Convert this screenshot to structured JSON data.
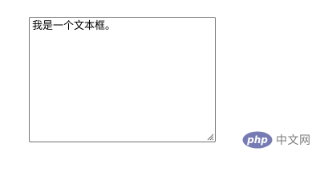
{
  "textarea": {
    "value": "我是一个文本框。"
  },
  "watermark": {
    "logo_text": "php",
    "site_text": "中文网",
    "logo_color": "#777bb3"
  }
}
